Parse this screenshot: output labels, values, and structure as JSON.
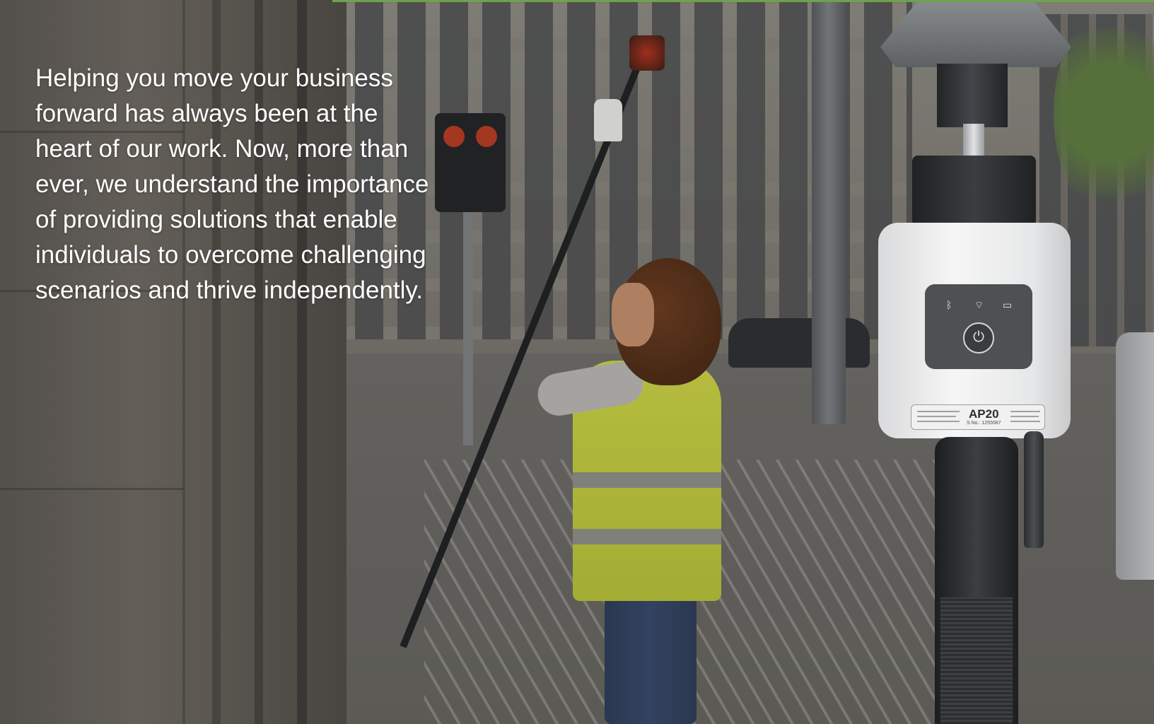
{
  "tagline": {
    "lines": [
      "Helping you move your business",
      "forward has always been at the",
      "heart of our work. Now, more than",
      "ever, we understand the importance",
      "of providing solutions that enable",
      "individuals to overcome challenging",
      "scenarios and thrive independently."
    ]
  },
  "device": {
    "model": "AP20",
    "serial": "S.No.: 1255587",
    "icons": [
      "bluetooth-icon",
      "wifi-icon",
      "battery-icon",
      "power-icon"
    ]
  },
  "colors": {
    "text": "#ffffff",
    "accent": "#6ea24c",
    "vest": "#c9d142"
  }
}
